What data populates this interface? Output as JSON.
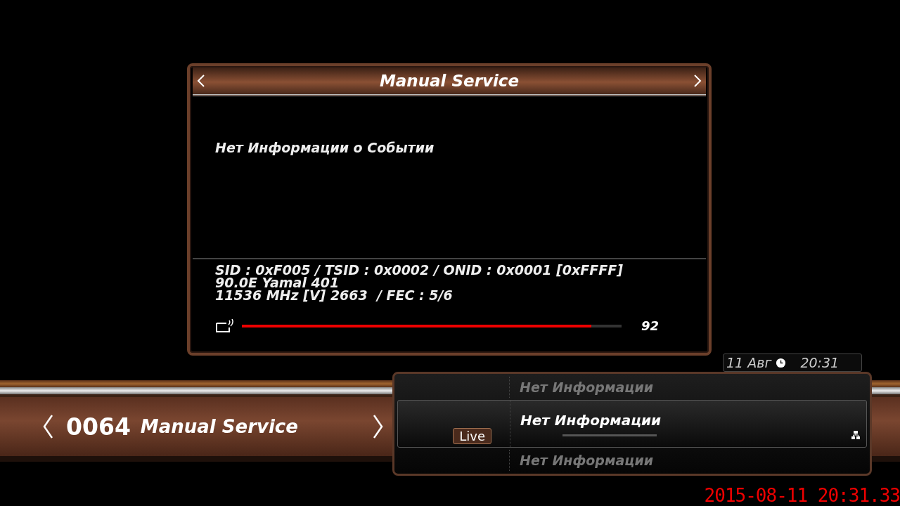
{
  "info_panel": {
    "title": "Manual Service",
    "event": "Нет Информации о Событии",
    "details": [
      "SID : 0xF005 / TSID : 0x0002 / ONID : 0x0001 [0xFFFF]",
      "90.0E Yamal 401",
      "11536 MHz [V] 2663  / FEC : 5/6"
    ],
    "signal": {
      "level": 0.92,
      "reading": "92"
    }
  },
  "clock": {
    "date": "11 Авг",
    "time": "20:31"
  },
  "channel_bar": {
    "number": "0064",
    "name": "Manual Service"
  },
  "epg": {
    "rows": [
      {
        "title": "Нет Информации",
        "selected": false
      },
      {
        "title": "Нет Информации",
        "selected": true,
        "badge": "Live"
      },
      {
        "title": "Нет Информации",
        "selected": false
      }
    ]
  },
  "timestamp": "2015-08-11 20:31.33"
}
